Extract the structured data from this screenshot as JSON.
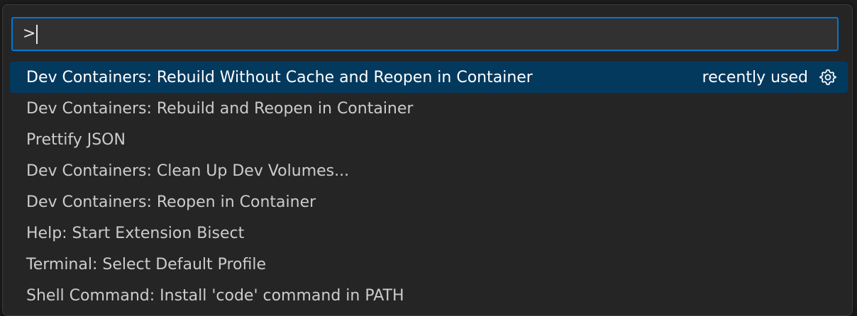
{
  "input": {
    "value": ">"
  },
  "items": [
    {
      "label": "Dev Containers: Rebuild Without Cache and Reopen in Container",
      "meta": "recently used",
      "selected": true
    },
    {
      "label": "Dev Containers: Rebuild and Reopen in Container"
    },
    {
      "label": "Prettify JSON"
    },
    {
      "label": "Dev Containers: Clean Up Dev Volumes..."
    },
    {
      "label": "Dev Containers: Reopen in Container"
    },
    {
      "label": "Help: Start Extension Bisect"
    },
    {
      "label": "Terminal: Select Default Profile"
    },
    {
      "label": "Shell Command: Install 'code' command in PATH"
    }
  ],
  "icons": {
    "configure": "gear-icon"
  },
  "colors": {
    "accent": "#0078d4",
    "selection": "#04395e",
    "background": "#252526"
  }
}
